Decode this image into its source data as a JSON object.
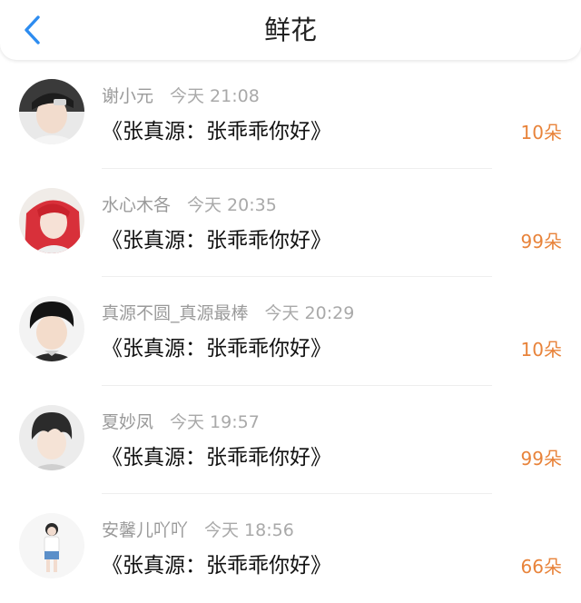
{
  "header": {
    "title": "鲜花"
  },
  "colors": {
    "count": "#e8833a",
    "name": "#9a9a9a",
    "time": "#a9a9a9"
  },
  "items": [
    {
      "name": "谢小元",
      "time": "今天 21:08",
      "message": "《张真源：张乖乖你好》",
      "count": "10朵",
      "avatar_icon": "avatar-boy-cap"
    },
    {
      "name": "水心木各",
      "time": "今天 20:35",
      "message": "《张真源：张乖乖你好》",
      "count": "99朵",
      "avatar_icon": "avatar-girl-red-hair"
    },
    {
      "name": "真源不圆_真源最棒",
      "time": "今天 20:29",
      "message": "《张真源：张乖乖你好》",
      "count": "10朵",
      "avatar_icon": "avatar-boy-black-hair"
    },
    {
      "name": "夏妙凤",
      "time": "今天 19:57",
      "message": "《张真源：张乖乖你好》",
      "count": "99朵",
      "avatar_icon": "avatar-boy-bangs"
    },
    {
      "name": "安馨儿吖吖",
      "time": "今天 18:56",
      "message": "《张真源：张乖乖你好》",
      "count": "66朵",
      "avatar_icon": "avatar-girl-full-body"
    }
  ]
}
